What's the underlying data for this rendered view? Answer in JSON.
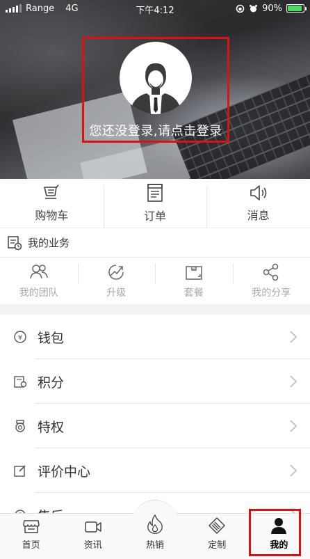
{
  "status_bar": {
    "carrier": "Range",
    "network": "4G",
    "time": "下午4:12",
    "battery": "90%",
    "battery_level": 0.9
  },
  "profile": {
    "login_prompt": "您还没登录,请点击登录"
  },
  "quick_actions": [
    {
      "label": "购物车",
      "icon": "cart-icon"
    },
    {
      "label": "订单",
      "icon": "order-icon"
    },
    {
      "label": "消息",
      "icon": "speaker-icon"
    }
  ],
  "business": {
    "title": "我的业务",
    "items": [
      {
        "label": "我的团队",
        "icon": "team-icon"
      },
      {
        "label": "升级",
        "icon": "upgrade-icon"
      },
      {
        "label": "套餐",
        "icon": "package-icon"
      },
      {
        "label": "我的分享",
        "icon": "share-icon"
      }
    ]
  },
  "menu": [
    {
      "label": "钱包",
      "icon": "wallet-icon"
    },
    {
      "label": "积分",
      "icon": "points-icon"
    },
    {
      "label": "特权",
      "icon": "privilege-icon"
    },
    {
      "label": "评价中心",
      "icon": "review-icon"
    },
    {
      "label": "售后",
      "icon": "after-sales-icon"
    }
  ],
  "tabbar": [
    {
      "label": "首页",
      "icon": "store-icon"
    },
    {
      "label": "资讯",
      "icon": "video-icon"
    },
    {
      "label": "热销",
      "icon": "flame-icon"
    },
    {
      "label": "定制",
      "icon": "layers-icon"
    },
    {
      "label": "我的",
      "icon": "person-icon",
      "active": true
    }
  ],
  "colors": {
    "highlight_border": "#dd1111",
    "battery_green": "#4cd964"
  }
}
